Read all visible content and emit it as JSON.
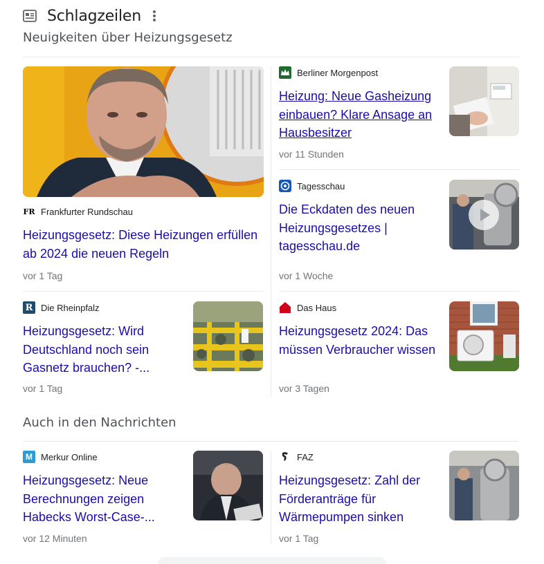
{
  "header": {
    "title": "Schlagzeilen",
    "icon": "newspaper-icon",
    "more_icon": "more-vert-icon"
  },
  "sections": {
    "top_topic": "Neuigkeiten über Heizungsgesetz",
    "also_in_news": "Auch in den Nachrichten"
  },
  "colors": {
    "link": "#1a0dab",
    "meta": "#70757a",
    "divider": "#e8eaed"
  },
  "articles": [
    {
      "source": "Frankfurter Rundschau",
      "favicon": "FR",
      "headline": "Heizungsgesetz: Diese Heizungen erfüllen ab 2024 die neuen Regeln",
      "time": "vor 1 Tag"
    },
    {
      "source": "Berliner Morgenpost",
      "favicon": "berliner-morgenpost-icon",
      "headline": "Heizung: Neue Gasheizung einbauen? Klare Ansage an Hausbesitzer",
      "time": "vor 11 Stunden"
    },
    {
      "source": "Tagesschau",
      "favicon": "tagesschau-icon",
      "headline": "Die Eckdaten des neuen Heizungsgesetzes | tagesschau.de",
      "time": "vor 1 Woche"
    },
    {
      "source": "Die Rheinpfalz",
      "favicon": "R",
      "headline": "Heizungsgesetz: Wird Deutschland noch sein Gasnetz brauchen? -...",
      "time": "vor 1 Tag"
    },
    {
      "source": "Das Haus",
      "favicon": "house-icon",
      "headline": "Heizungsgesetz 2024: Das müssen Verbraucher wissen",
      "time": "vor 3 Tagen"
    },
    {
      "source": "Merkur Online",
      "favicon": "M",
      "headline": "Heizungsgesetz: Neue Berechnungen zeigen Habecks Worst-Case-...",
      "time": "vor 12 Minuten"
    },
    {
      "source": "FAZ",
      "favicon": "faz-icon",
      "headline": "Heizungsgesetz: Zahl der Förderanträge für Wärmepumpen sinken",
      "time": "vor 1 Tag"
    }
  ]
}
